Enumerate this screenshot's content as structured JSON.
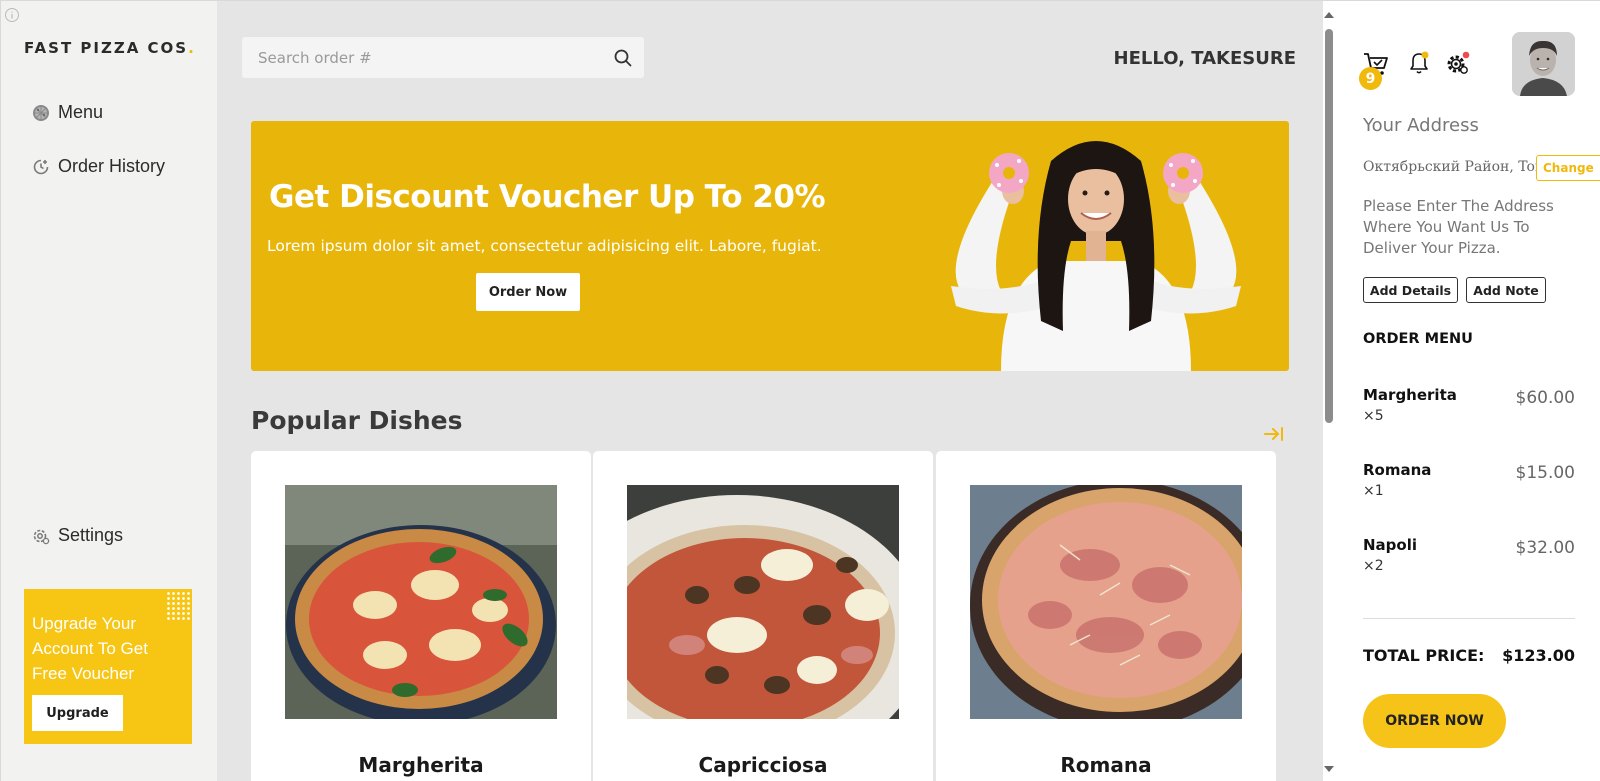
{
  "brand": {
    "name": "FAST PIZZA COS",
    "dot": ".",
    "accent": "#f0b90b"
  },
  "sidebar": {
    "items": [
      {
        "label": "Menu",
        "icon": "pizza-icon"
      },
      {
        "label": "Order History",
        "icon": "history-icon"
      }
    ],
    "settings_label": "Settings",
    "upgrade": {
      "text": "Upgrade Your Account To Get Free Voucher",
      "button": "Upgrade"
    }
  },
  "header": {
    "search_placeholder": "Search order #",
    "greeting": "HELLO, TAKESURE"
  },
  "banner": {
    "title": "Get Discount Voucher Up To 20%",
    "subtitle": "Lorem ipsum dolor sit amet, consectetur adipisicing elit. Labore, fugiat.",
    "button": "Order Now",
    "color": "#e8b60b"
  },
  "popular": {
    "title": "Popular Dishes",
    "dishes": [
      {
        "name": "Margherita"
      },
      {
        "name": "Capricciosa"
      },
      {
        "name": "Romana"
      }
    ]
  },
  "right_panel": {
    "cart_count": "9",
    "address_title": "Your Address",
    "address_value": "Октябрьский Район, Tomsk",
    "change_label": "Change",
    "address_help": "Please Enter The Address Where You Want Us To Deliver Your Pizza.",
    "add_details": "Add Details",
    "add_note": "Add Note",
    "order_menu_title": "ORDER MENU",
    "orders": [
      {
        "name": "Margherita",
        "qty": "×5",
        "price": "$60.00"
      },
      {
        "name": "Romana",
        "qty": "×1",
        "price": "$15.00"
      },
      {
        "name": "Napoli",
        "qty": "×2",
        "price": "$32.00"
      }
    ],
    "total_label": "TOTAL PRICE:",
    "total_value": "$123.00",
    "order_now": "ORDER NOW"
  }
}
